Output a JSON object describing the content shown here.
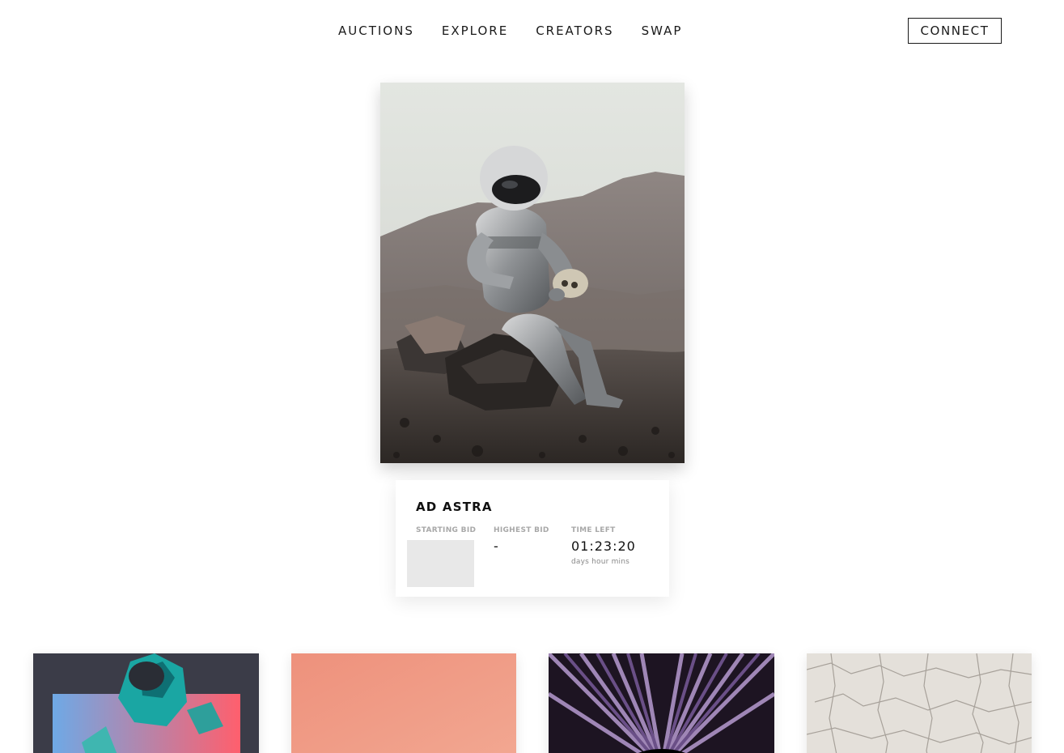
{
  "nav": {
    "links": [
      "AUCTIONS",
      "EXPLORE",
      "CREATORS",
      "SWAP"
    ],
    "connect_label": "CONNECT"
  },
  "featured": {
    "image_icon": "astronaut-holding-skull-artwork",
    "title": "AD ASTRA",
    "starting_bid_label": "STARTING BID",
    "starting_bid_value": "",
    "highest_bid_label": "HIGHEST BID",
    "highest_bid_value": "-",
    "time_left_label": "TIME LEFT",
    "time_left_value": "01:23:20",
    "time_left_units": "days hour  mins"
  },
  "gallery": [
    {
      "icon": "crystal-astronaut-artwork"
    },
    {
      "icon": "peach-gradient-artwork"
    },
    {
      "icon": "purple-tunnel-artwork"
    },
    {
      "icon": "cracked-earth-artwork"
    }
  ],
  "colors": {
    "text": "#1a1a1a",
    "label_gray": "#a8a8a8",
    "placeholder": "#e8e8e8"
  }
}
